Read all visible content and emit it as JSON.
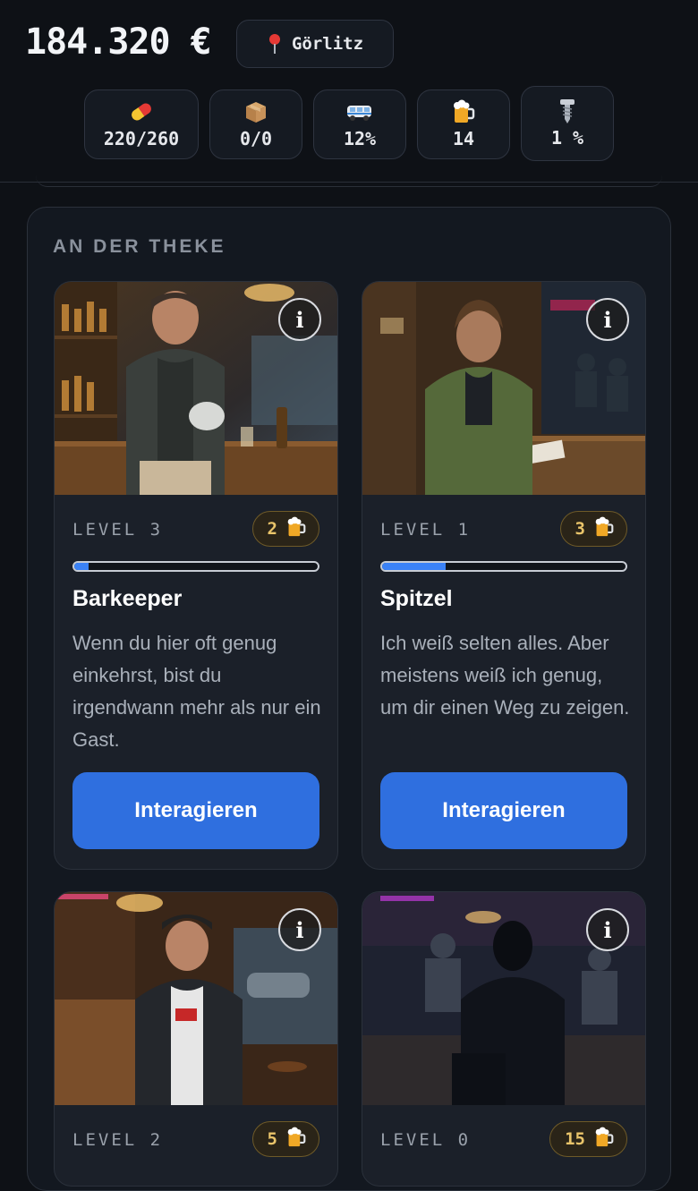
{
  "header": {
    "money": "184.320 €",
    "location": "Görlitz",
    "stats": [
      {
        "icon": "pill-icon",
        "value": "220/260"
      },
      {
        "icon": "box-icon",
        "value": "0/0"
      },
      {
        "icon": "van-icon",
        "value": "12%"
      },
      {
        "icon": "beer-icon",
        "value": "14"
      },
      {
        "icon": "screw-icon",
        "value": "1 %"
      }
    ]
  },
  "section": {
    "title": "AN DER THEKE",
    "cards": [
      {
        "level": "LEVEL 3",
        "cost": "2",
        "progress": 0.06,
        "name": "Barkeeper",
        "description": "Wenn du hier oft genug einkehrst, bist du irgendwann mehr als nur ein Gast.",
        "button": "Interagieren",
        "info": "i"
      },
      {
        "level": "LEVEL 1",
        "cost": "3",
        "progress": 0.26,
        "name": "Spitzel",
        "description": "Ich weiß selten alles. Aber meistens weiß ich genug, um dir einen Weg zu zeigen.",
        "button": "Interagieren",
        "info": "i"
      },
      {
        "level": "LEVEL 2",
        "cost": "5",
        "info": "i"
      },
      {
        "level": "LEVEL 0",
        "cost": "15",
        "info": "i"
      }
    ]
  },
  "colors": {
    "background": "#0e1116",
    "accent": "#2f6fdf",
    "progress": "#3b82f6",
    "cost_text": "#e9c46a"
  }
}
